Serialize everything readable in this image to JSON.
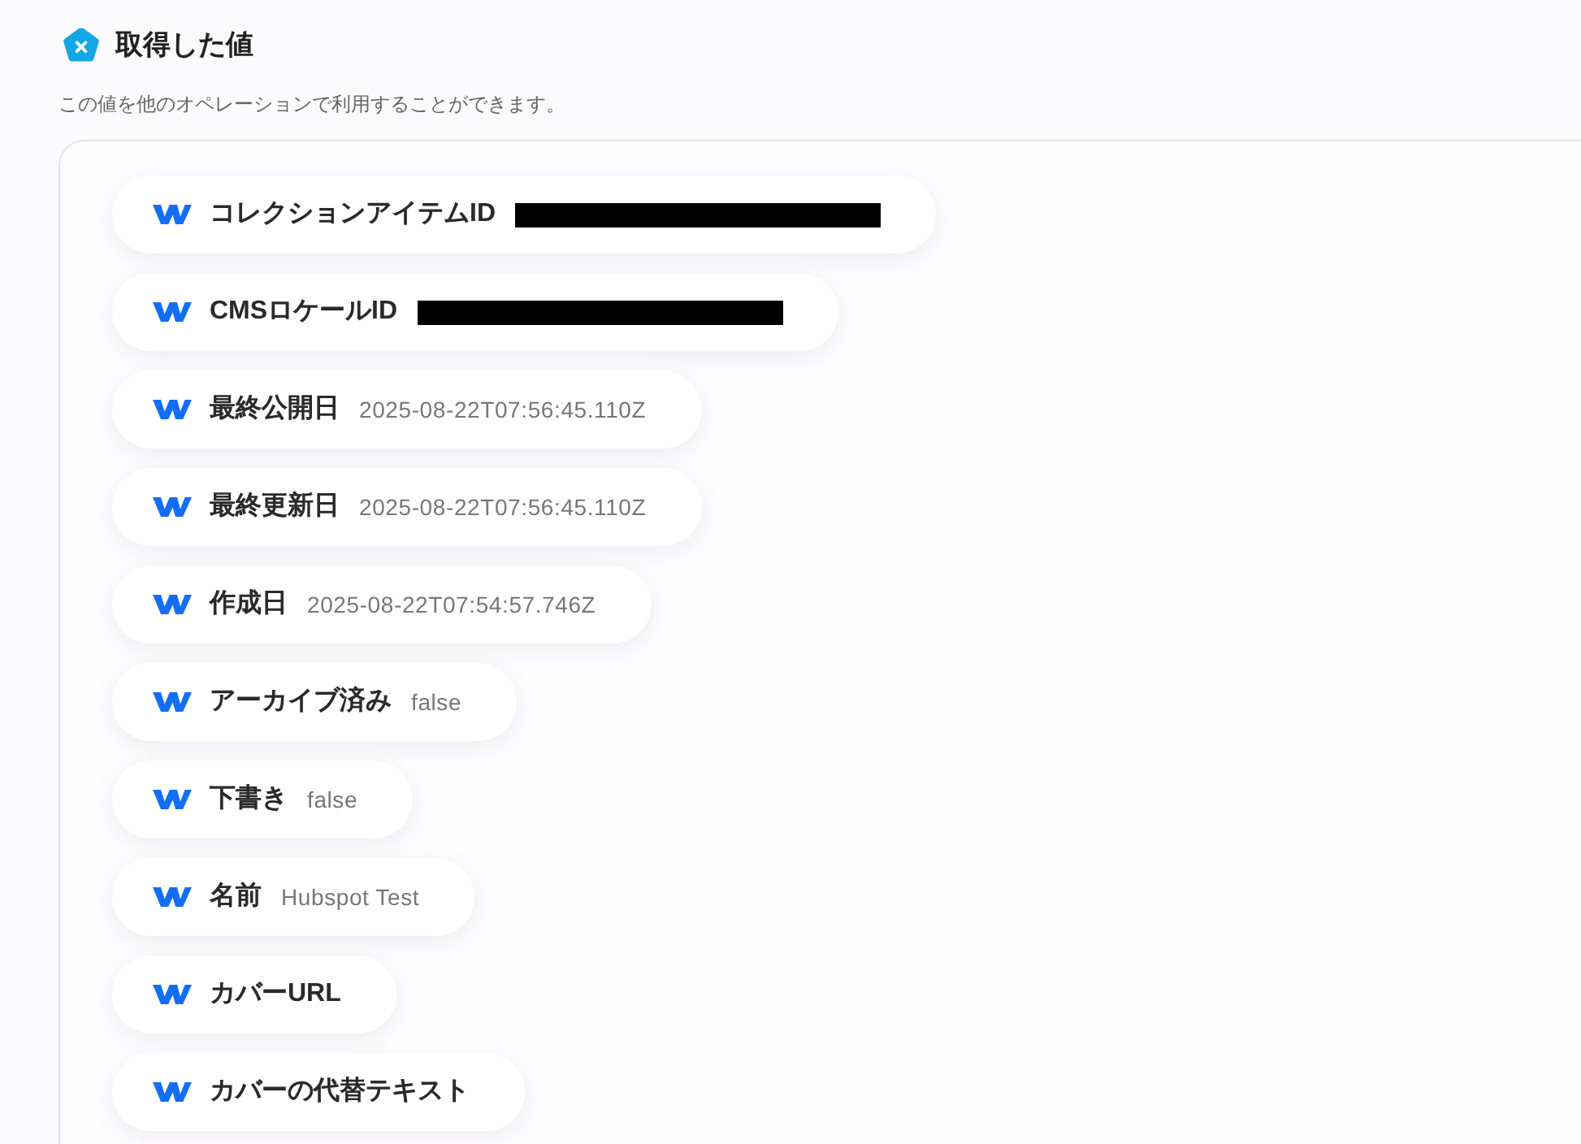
{
  "header": {
    "title": "取得した値",
    "description": "この値を他のオペレーションで利用することができます。"
  },
  "values": [
    {
      "label": "コレクションアイテムID",
      "redacted": true
    },
    {
      "label": "CMSロケールID",
      "redacted": true
    },
    {
      "label": "最終公開日",
      "value": "2025-08-22T07:56:45.110Z",
      "redacted": false
    },
    {
      "label": "最終更新日",
      "value": "2025-08-22T07:56:45.110Z",
      "redacted": false
    },
    {
      "label": "作成日",
      "value": "2025-08-22T07:54:57.746Z",
      "redacted": false
    },
    {
      "label": "アーカイブ済み",
      "value": "false",
      "redacted": false
    },
    {
      "label": "下書き",
      "value": "false",
      "redacted": false
    },
    {
      "label": "名前",
      "value": "Hubspot Test",
      "redacted": false
    },
    {
      "label": "カバーURL",
      "redacted": false
    },
    {
      "label": "カバーの代替テキスト",
      "redacted": false
    }
  ]
}
